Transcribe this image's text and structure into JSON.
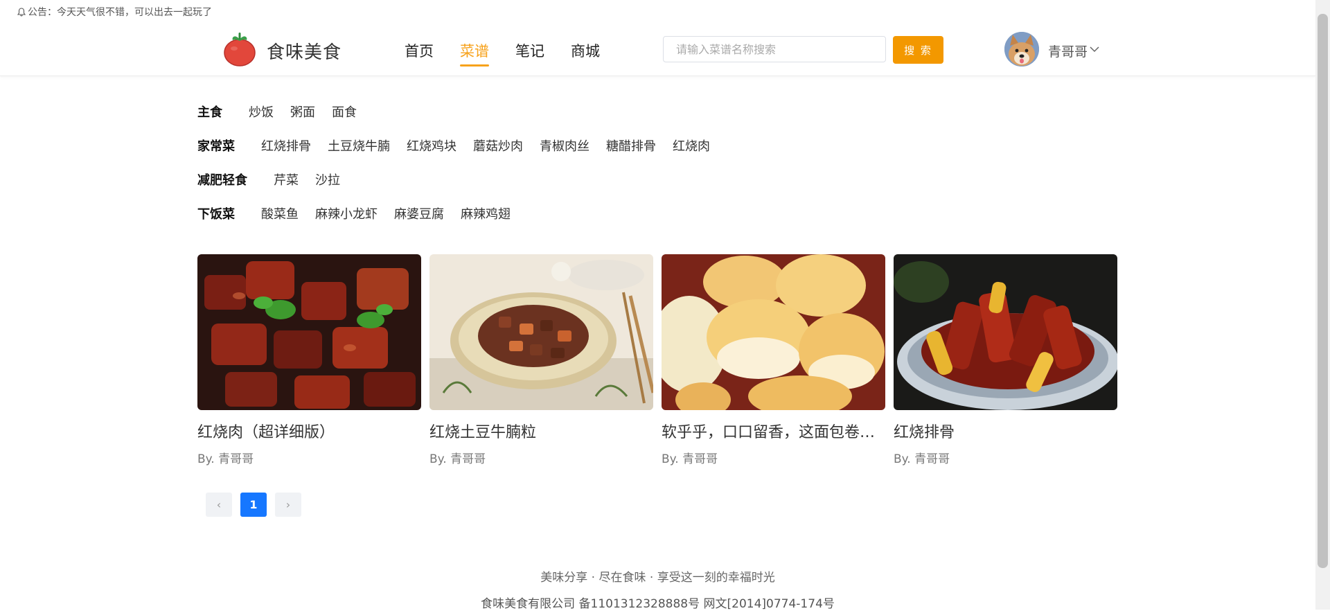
{
  "notice": {
    "text": "公告：今天天气很不错，可以出去一起玩了",
    "icon": "bell-icon"
  },
  "brand": {
    "name": "食味美食",
    "logo": "tomato-logo"
  },
  "nav": {
    "items": [
      {
        "label": "首页",
        "active": false
      },
      {
        "label": "菜谱",
        "active": true
      },
      {
        "label": "笔记",
        "active": false
      },
      {
        "label": "商城",
        "active": false
      }
    ]
  },
  "search": {
    "placeholder": "请输入菜谱名称搜索",
    "button_label": "搜 索"
  },
  "user": {
    "name": "青哥哥",
    "avatar": "dog-avatar"
  },
  "categories": [
    {
      "title": "主食",
      "items": [
        "炒饭",
        "粥面",
        "面食"
      ]
    },
    {
      "title": "家常菜",
      "items": [
        "红烧排骨",
        "土豆烧牛腩",
        "红烧鸡块",
        "蘑菇炒肉",
        "青椒肉丝",
        "糖醋排骨",
        "红烧肉"
      ]
    },
    {
      "title": "减肥轻食",
      "items": [
        "芹菜",
        "沙拉"
      ]
    },
    {
      "title": "下饭菜",
      "items": [
        "酸菜鱼",
        "麻辣小龙虾",
        "麻婆豆腐",
        "麻辣鸡翅"
      ]
    }
  ],
  "recipes": [
    {
      "title": "红烧肉（超详细版）",
      "author": "By. 青哥哥"
    },
    {
      "title": "红烧土豆牛腩粒",
      "author": "By. 青哥哥"
    },
    {
      "title": "软乎乎，口口留香，这面包卷…",
      "author": "By. 青哥哥"
    },
    {
      "title": "红烧排骨",
      "author": "By. 青哥哥"
    }
  ],
  "pagination": {
    "prev": "‹",
    "current": "1",
    "next": "›"
  },
  "footer": {
    "slogan": "美味分享 · 尽在食味 · 享受这一刻的幸福时光",
    "copyright": "食味美食有限公司 备1101312328888号 网文[2014]0774-174号"
  },
  "colors": {
    "accent": "#f39800",
    "nav_active": "#f7a21b",
    "pager_active": "#1677ff"
  }
}
